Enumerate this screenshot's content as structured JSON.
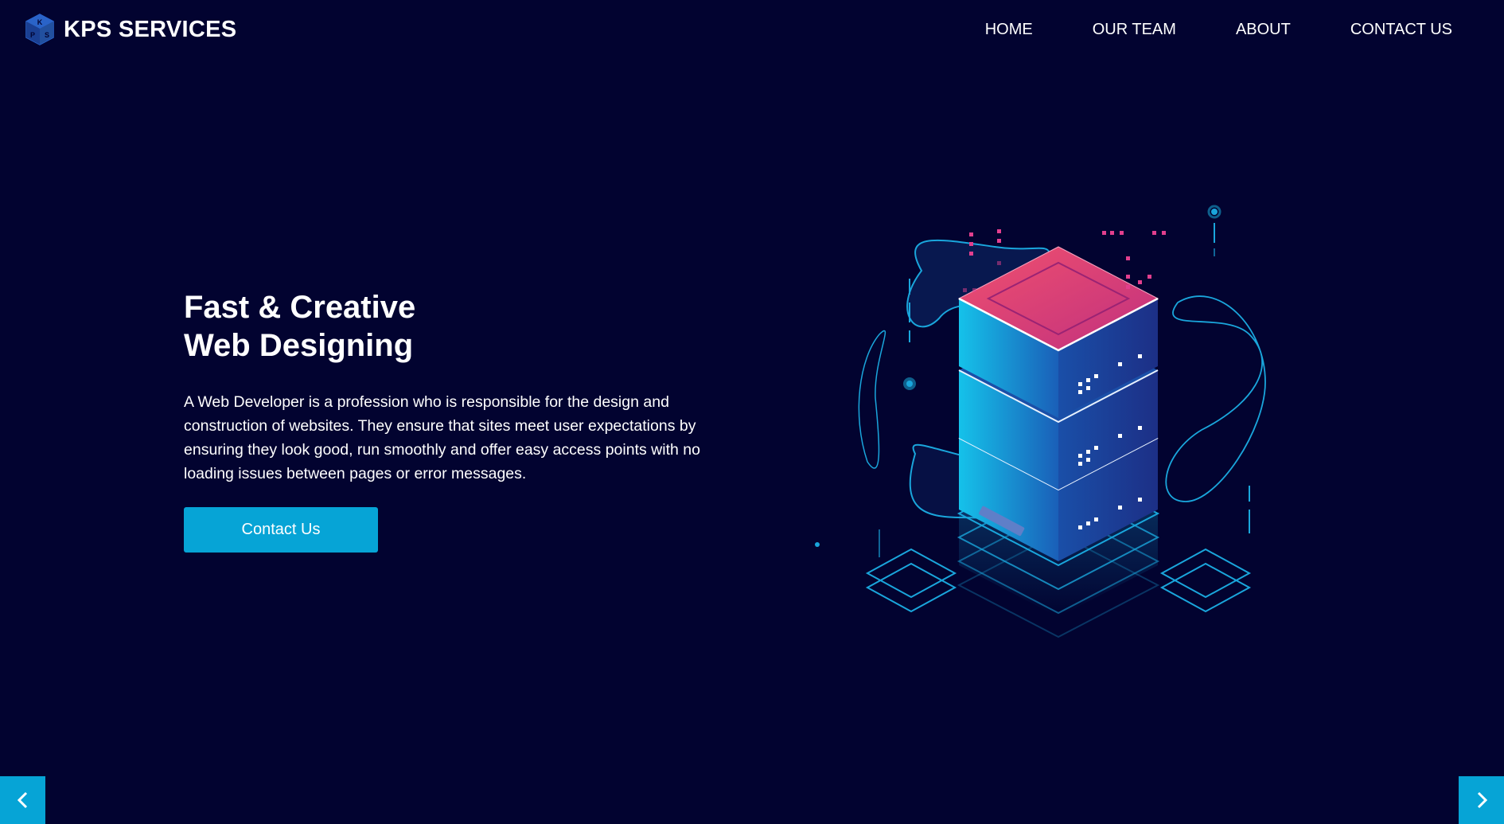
{
  "brand": {
    "logo_icon": "kps-cube-logo-icon",
    "logo_letters": [
      "K",
      "P",
      "S"
    ],
    "name": "KPS SERVICES"
  },
  "nav": {
    "items": [
      {
        "label": "HOME"
      },
      {
        "label": "OUR TEAM"
      },
      {
        "label": "ABOUT"
      },
      {
        "label": "CONTACT US"
      }
    ]
  },
  "hero": {
    "title_line1": "Fast & Creative",
    "title_line2": "Web Designing",
    "description": "A Web Developer is a profession who is responsible for the design and construction of websites. They ensure that sites meet user expectations by ensuring they look good, run smoothly and offer easy access points with no loading issues between pages or error messages.",
    "button_label": "Contact Us",
    "illustration_icon": "isometric-server-stack-icon"
  },
  "slider": {
    "prev_icon": "chevron-left-icon",
    "next_icon": "chevron-right-icon"
  },
  "colors": {
    "background": "#020330",
    "accent": "#06a4d6",
    "server_top": "#e0447a",
    "server_side": "#1296d3"
  }
}
